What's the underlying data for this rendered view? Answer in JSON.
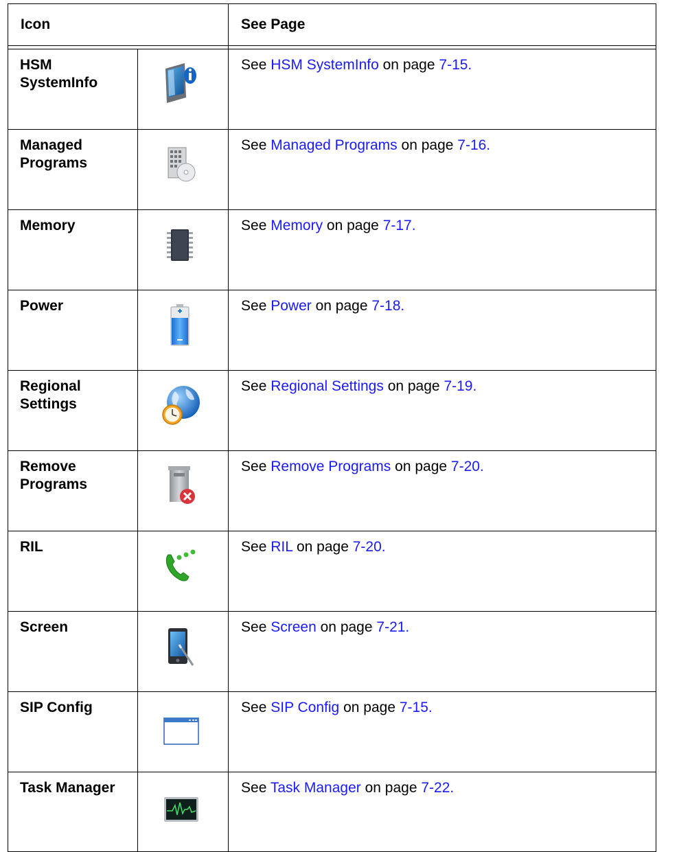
{
  "header": {
    "col_icon": "Icon",
    "col_see": "See Page"
  },
  "text": {
    "see": "See",
    "on_page": "on page"
  },
  "colors": {
    "link": "#1a1aff",
    "border": "#000000"
  },
  "rows": [
    {
      "name": "HSM SystemInfo",
      "icon": "device-info-icon",
      "link": "HSM SystemInfo",
      "page": "7-15."
    },
    {
      "name": "Managed Programs",
      "icon": "building-disc-icon",
      "link": "Managed Programs",
      "page": "7-16."
    },
    {
      "name": "Memory",
      "icon": "memory-chip-icon",
      "link": "Memory",
      "page": "7-17."
    },
    {
      "name": "Power",
      "icon": "battery-icon",
      "link": "Power",
      "page": "7-18."
    },
    {
      "name": "Regional Settings",
      "icon": "globe-clock-icon",
      "link": "Regional Settings",
      "page": "7-19."
    },
    {
      "name": "Remove Programs",
      "icon": "trash-remove-icon",
      "link": "Remove Programs",
      "page": "7-20."
    },
    {
      "name": "RIL",
      "icon": "phone-dots-icon",
      "link": "RIL",
      "page": "7-20."
    },
    {
      "name": "Screen",
      "icon": "screen-stylus-icon",
      "link": "Screen",
      "page": "7-21."
    },
    {
      "name": "SIP Config",
      "icon": "window-icon",
      "link": "SIP Config",
      "page": "7-15."
    },
    {
      "name": "Task Manager",
      "icon": "activity-monitor-icon",
      "link": "Task Manager",
      "page": "7-22."
    }
  ]
}
